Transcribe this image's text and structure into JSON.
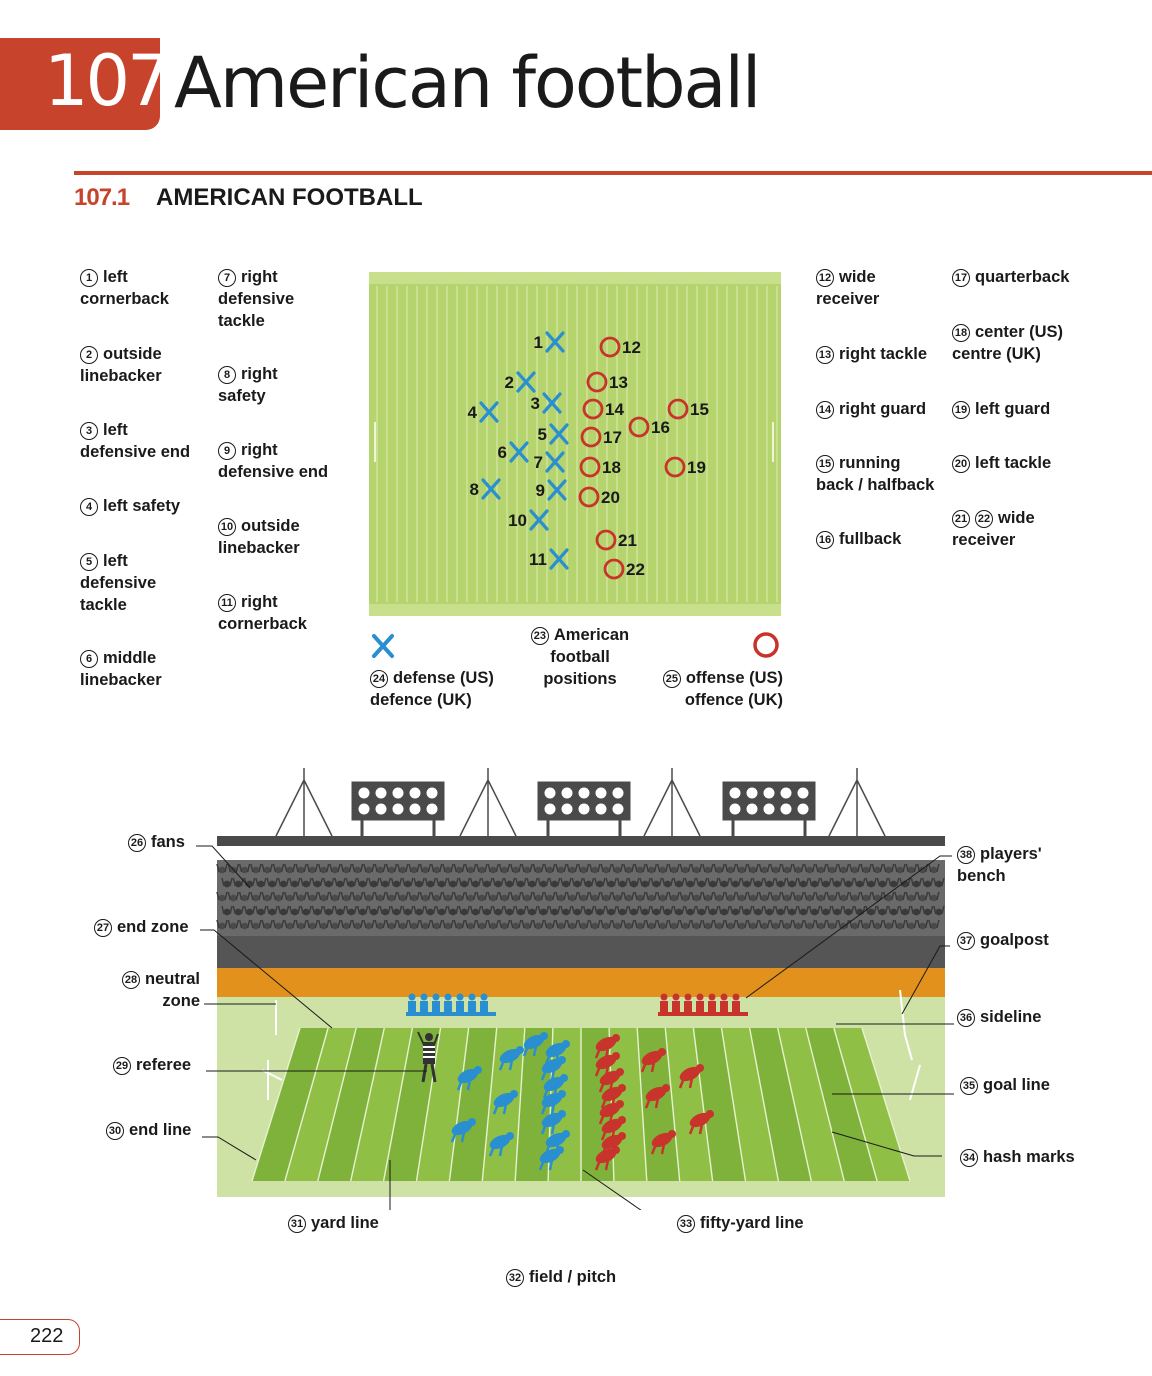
{
  "header": {
    "chapter_number": "107",
    "chapter_title": "American football"
  },
  "section": {
    "number": "107.1",
    "title": "AMERICAN FOOTBALL"
  },
  "labels": [
    {
      "n": "1",
      "text": "left\ncornerback"
    },
    {
      "n": "2",
      "text": "outside\nlinebacker"
    },
    {
      "n": "3",
      "text": "left\ndefensive end"
    },
    {
      "n": "4",
      "text": "left safety"
    },
    {
      "n": "5",
      "text": "left\ndefensive\ntackle"
    },
    {
      "n": "6",
      "text": "middle\nlinebacker"
    },
    {
      "n": "7",
      "text": "right\ndefensive\ntackle"
    },
    {
      "n": "8",
      "text": "right\nsafety"
    },
    {
      "n": "9",
      "text": "right\ndefensive end"
    },
    {
      "n": "10",
      "text": "outside\nlinebacker"
    },
    {
      "n": "11",
      "text": "right\ncornerback"
    },
    {
      "n": "12",
      "text": "wide\nreceiver"
    },
    {
      "n": "13",
      "text": "right tackle"
    },
    {
      "n": "14",
      "text": "right guard"
    },
    {
      "n": "15",
      "text": "running\nback / halfback"
    },
    {
      "n": "16",
      "text": "fullback"
    },
    {
      "n": "17",
      "text": "quarterback"
    },
    {
      "n": "18",
      "text": "center (US)\ncentre (UK)"
    },
    {
      "n": "19",
      "text": "left guard"
    },
    {
      "n": "20",
      "text": "left tackle"
    },
    {
      "n": "21",
      "text": ""
    },
    {
      "n": "22",
      "text": "wide\nreceiver"
    },
    {
      "n": "23",
      "text": "American\nfootball\npositions"
    },
    {
      "n": "24",
      "text": "defense (US)\ndefence (UK)"
    },
    {
      "n": "25",
      "text": "offense (US)\noffence (UK)"
    },
    {
      "n": "26",
      "text": "fans"
    },
    {
      "n": "27",
      "text": "end zone"
    },
    {
      "n": "28",
      "text": "neutral\nzone"
    },
    {
      "n": "29",
      "text": "referee"
    },
    {
      "n": "30",
      "text": "end line"
    },
    {
      "n": "31",
      "text": "yard line"
    },
    {
      "n": "32",
      "text": "field / pitch"
    },
    {
      "n": "33",
      "text": "fifty-yard line"
    },
    {
      "n": "34",
      "text": "hash marks"
    },
    {
      "n": "35",
      "text": "goal line"
    },
    {
      "n": "36",
      "text": "sideline"
    },
    {
      "n": "37",
      "text": "goalpost"
    },
    {
      "n": "38",
      "text": "players'\nbench"
    }
  ],
  "formation": {
    "defense_markers": [
      "1",
      "2",
      "3",
      "4",
      "5",
      "6",
      "7",
      "8",
      "9",
      "10",
      "11"
    ],
    "offense_markers": [
      "12",
      "13",
      "14",
      "15",
      "16",
      "17",
      "18",
      "19",
      "20",
      "21",
      "22"
    ]
  },
  "colors": {
    "accent": "#c8432b",
    "defense": "#2a8fd0",
    "offense": "#c8332b",
    "field": "#a9cc5a",
    "stand_band": "#e2921c"
  },
  "footer": {
    "page_number": "222"
  }
}
